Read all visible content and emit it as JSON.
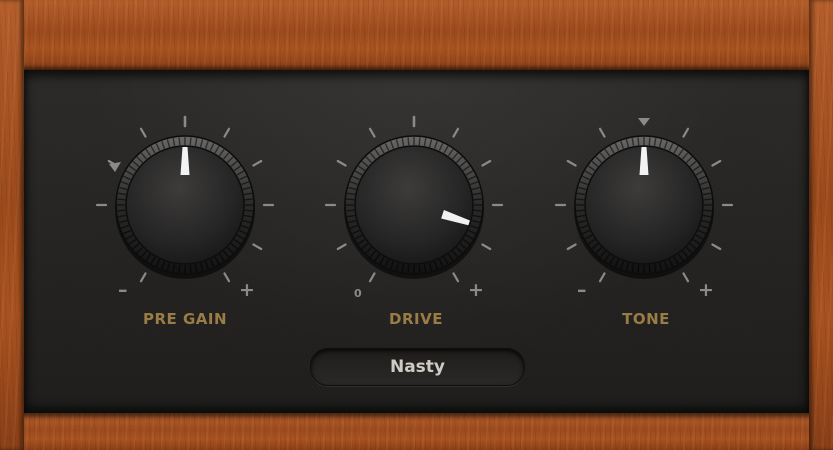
{
  "plugin": {
    "knobs": [
      {
        "id": "pre-gain",
        "label": "PRE GAIN",
        "value": 0.5,
        "min_label": "–",
        "max_label": "+",
        "has_top_marker": false,
        "has_left_marker": true
      },
      {
        "id": "drive",
        "label": "DRIVE",
        "value": 0.86,
        "min_label": "0",
        "max_label": "+",
        "has_top_marker": false,
        "has_left_marker": false
      },
      {
        "id": "tone",
        "label": "TONE",
        "value": 0.5,
        "min_label": "–",
        "max_label": "+",
        "has_top_marker": true,
        "has_left_marker": false
      }
    ],
    "mode": {
      "selected": "Nasty"
    },
    "colors": {
      "wood": "#a8521f",
      "panel": "#252423",
      "label": "#9a7c45",
      "tick": "#8c8a86",
      "pointer": "#f2f2f2"
    }
  }
}
